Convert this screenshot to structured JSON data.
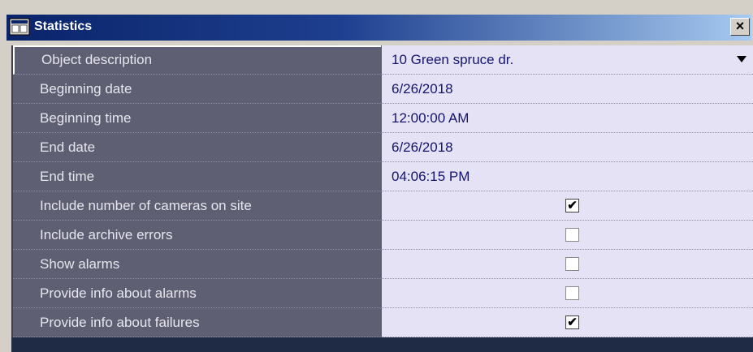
{
  "window": {
    "title": "Statistics",
    "close_label": "×"
  },
  "rows": [
    {
      "label": "Object description",
      "value": "10 Green spruce dr.",
      "type": "dropdown"
    },
    {
      "label": "Beginning date",
      "value": "6/26/2018",
      "type": "text"
    },
    {
      "label": "Beginning time",
      "value": "12:00:00 AM",
      "type": "text"
    },
    {
      "label": "End date",
      "value": "6/26/2018",
      "type": "text"
    },
    {
      "label": "End time",
      "value": "04:06:15 PM",
      "type": "text"
    },
    {
      "label": "Include number of cameras on site",
      "checked": true,
      "type": "checkbox"
    },
    {
      "label": "Include archive errors",
      "checked": false,
      "type": "checkbox"
    },
    {
      "label": "Show alarms",
      "checked": false,
      "type": "checkbox"
    },
    {
      "label": "Provide info about alarms",
      "checked": false,
      "type": "checkbox"
    },
    {
      "label": "Provide info about failures",
      "checked": true,
      "type": "checkbox"
    }
  ],
  "icons": {
    "title_icon": "window-app-icon",
    "dropdown_icon": "chevron-down-icon",
    "check_glyph": "✔"
  },
  "colors": {
    "title_bar": "#0a246a",
    "label_bg": "#5f5f73",
    "value_bg": "#e5e2f6"
  }
}
